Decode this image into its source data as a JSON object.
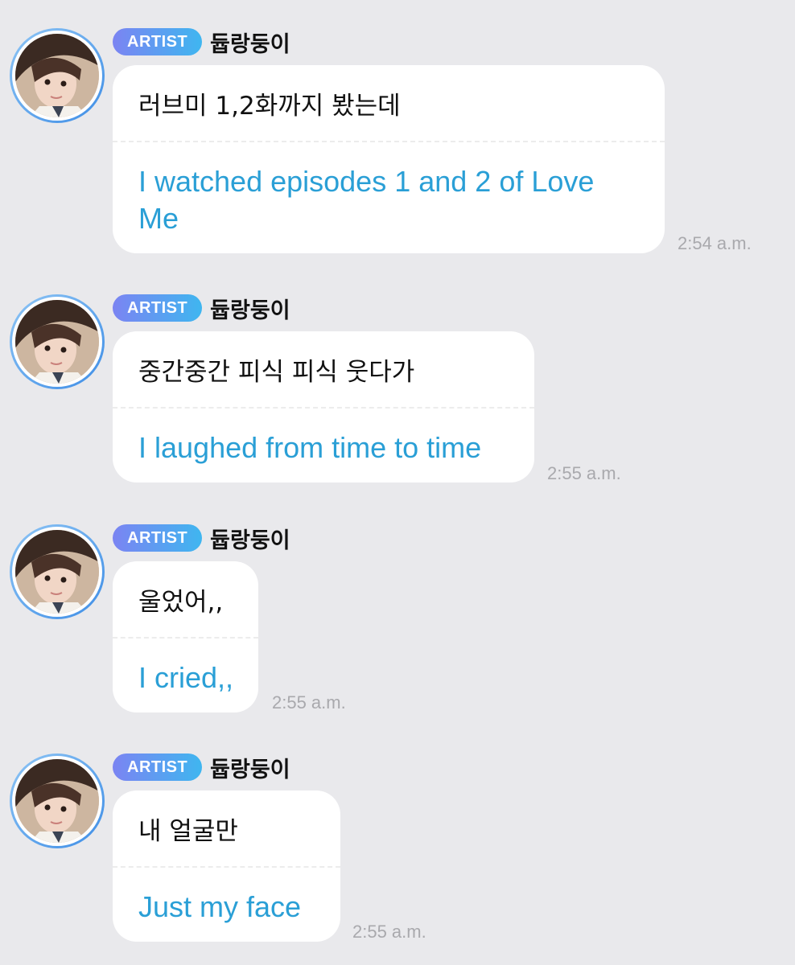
{
  "messages": [
    {
      "badge": "ARTIST",
      "sender": "듑랑둥이",
      "original": "러브미 1,2화까지 봤는데",
      "translation": "I watched episodes 1 and 2 of Love Me",
      "time": "2:54 a.m."
    },
    {
      "badge": "ARTIST",
      "sender": "듑랑둥이",
      "original": "중간중간 피식 피식 웃다가",
      "translation": "I laughed from time to time",
      "time": "2:55 a.m."
    },
    {
      "badge": "ARTIST",
      "sender": "듑랑둥이",
      "original": "울었어,,",
      "translation": "I cried,,",
      "time": "2:55 a.m."
    },
    {
      "badge": "ARTIST",
      "sender": "듑랑둥이",
      "original": "내 얼굴만",
      "translation": "Just my face",
      "time": "2:55 a.m."
    }
  ],
  "colors": {
    "background": "#e9e9ec",
    "translation": "#2a9fd6",
    "badge_start": "#7b84f2",
    "badge_end": "#3fb6f0",
    "avatar_ring": "#5aa6ee"
  }
}
